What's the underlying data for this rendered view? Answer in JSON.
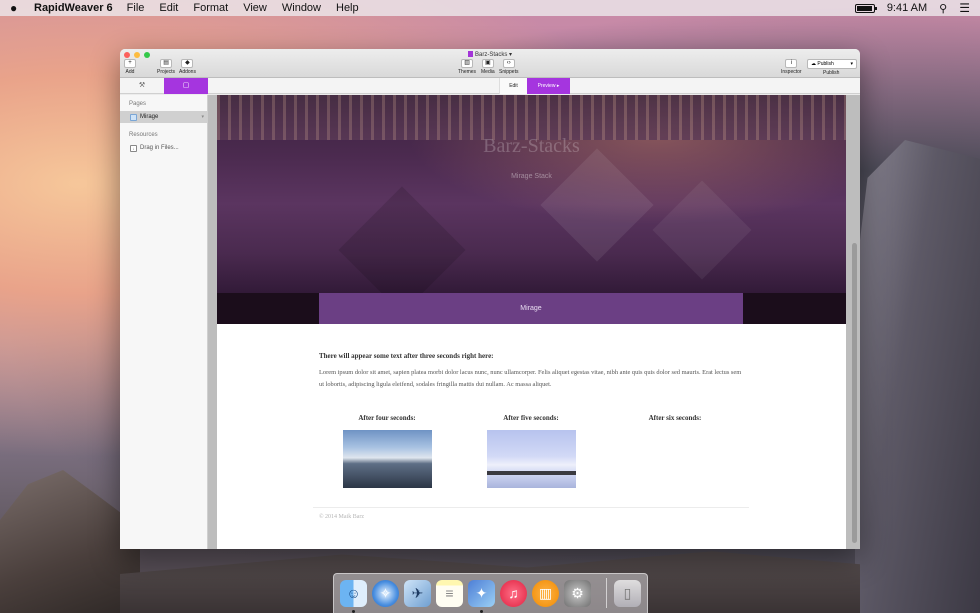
{
  "menubar": {
    "app_name": "RapidWeaver 6",
    "menus": [
      "File",
      "Edit",
      "Format",
      "View",
      "Window",
      "Help"
    ],
    "clock": "9:41 AM"
  },
  "window": {
    "document_title": "Barz-Stacks",
    "toolbar": {
      "add": "Add",
      "projects": "Projects",
      "addons": "Addons",
      "themes": "Themes",
      "media": "Media",
      "snippets": "Snippets",
      "inspector": "Inspector",
      "publish_button": "Publish",
      "publish_label": "Publish"
    },
    "modes": {
      "edit": "Edit",
      "preview": "Preview"
    }
  },
  "sidebar": {
    "pages_heading": "Pages",
    "page_item": "Mirage",
    "resources_heading": "Resources",
    "resource_item": "Drag in Files..."
  },
  "preview": {
    "hero_title": "Barz-Stacks",
    "hero_subtitle": "Mirage Stack",
    "nav_item": "Mirage",
    "heading": "There will appear some text after three seconds right here:",
    "paragraph": "Lorem ipsum dolor sit amet, sapien platea morbi dolor lacus nunc, nunc ullamcorper. Felis aliquet egestas vitae, nibh ante quis quis dolor sed mauris. Erat lectus sem ut lobortis, adipiscing ligula eleifend, sodales fringilla mattis dui nullam. Ac massa aliquet.",
    "col1": "After four seconds:",
    "col2": "After five seconds:",
    "col3": "After six seconds:",
    "footer": "© 2014 Maik Barz"
  },
  "colors": {
    "accent": "#a535df",
    "nav_purple": "#6b3f84"
  },
  "dock": [
    "Finder",
    "Safari",
    "Mail",
    "Notes",
    "RapidWeaver",
    "iTunes",
    "iBooks",
    "System Preferences",
    "Trash"
  ]
}
